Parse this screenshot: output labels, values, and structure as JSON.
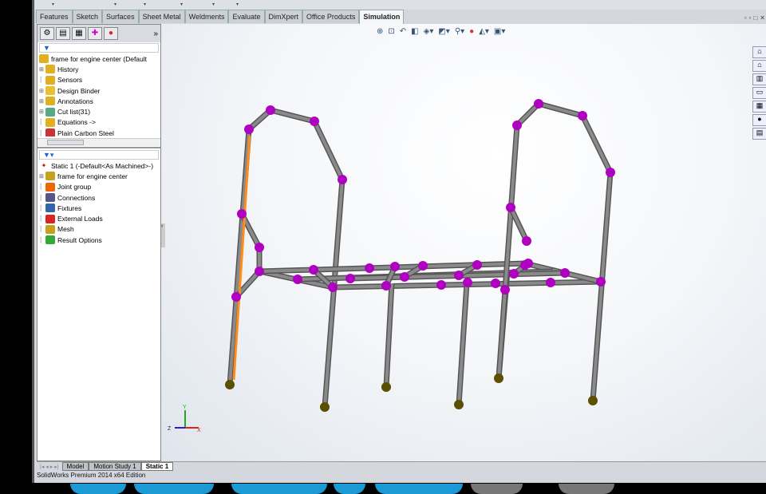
{
  "command_tabs": [
    "Features",
    "Sketch",
    "Surfaces",
    "Sheet Metal",
    "Weldments",
    "Evaluate",
    "DimXpert",
    "Office Products",
    "Simulation"
  ],
  "active_tab": "Simulation",
  "feature_tree": {
    "root": "frame for engine center  (Default",
    "items": [
      {
        "label": "History",
        "icon": "history-icon",
        "expand": true
      },
      {
        "label": "Sensors",
        "icon": "sensors-icon",
        "expand": false
      },
      {
        "label": "Design Binder",
        "icon": "design-binder-icon",
        "expand": true
      },
      {
        "label": "Annotations",
        "icon": "annotations-icon",
        "expand": true
      },
      {
        "label": "Cut list(31)",
        "icon": "cut-list-icon",
        "expand": true
      },
      {
        "label": "Equations ->",
        "icon": "equations-icon",
        "expand": false
      },
      {
        "label": "Plain Carbon Steel",
        "icon": "material-icon",
        "expand": false
      }
    ]
  },
  "study_tree": {
    "root": "Static 1 (-Default<As Machined>-)",
    "items": [
      {
        "label": "frame for engine center",
        "icon": "part-icon",
        "expand": true
      },
      {
        "label": "Joint group",
        "icon": "joint-group-icon",
        "expand": false
      },
      {
        "label": "Connections",
        "icon": "connections-icon",
        "expand": false
      },
      {
        "label": "Fixtures",
        "icon": "fixtures-icon",
        "expand": false
      },
      {
        "label": "External Loads",
        "icon": "external-loads-icon",
        "expand": false
      },
      {
        "label": "Mesh",
        "icon": "mesh-icon",
        "expand": false
      },
      {
        "label": "Result Options",
        "icon": "result-options-icon",
        "expand": false
      }
    ]
  },
  "bottom_tabs": [
    "Model",
    "Motion Study 1",
    "Static 1"
  ],
  "active_bottom_tab": "Static 1",
  "status": "SolidWorks Premium 2014 x64 Edition",
  "colors": {
    "joint": "#b000c0",
    "fixture": "#5a5000",
    "beam": "#8a8a8a",
    "selected": "#ff8c1a"
  },
  "triad": {
    "x": "X",
    "y": "Y",
    "z": "Z"
  }
}
